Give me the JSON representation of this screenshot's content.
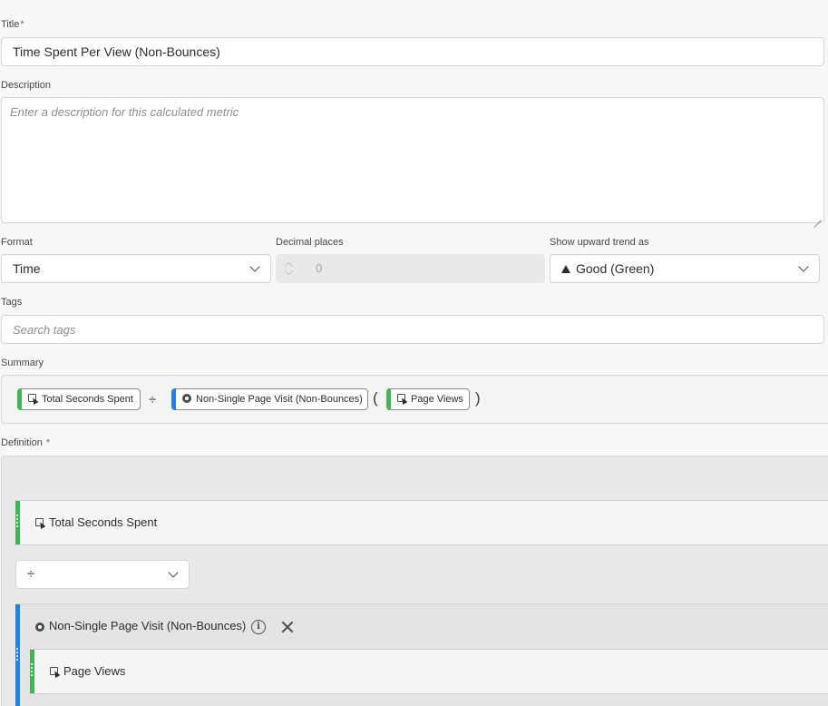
{
  "title": {
    "label": "Title",
    "required_mark": "*",
    "value": "Time Spent Per View (Non-Bounces)"
  },
  "description": {
    "label": "Description",
    "placeholder": "Enter a description for this calculated metric"
  },
  "format": {
    "label": "Format",
    "value": "Time"
  },
  "decimal_places": {
    "label": "Decimal places",
    "value": "0"
  },
  "upward_trend": {
    "label": "Show upward trend as",
    "value": "Good (Green)",
    "icon": "triangle-up-icon"
  },
  "tags": {
    "label": "Tags",
    "placeholder": "Search tags"
  },
  "summary": {
    "label": "Summary",
    "items": [
      {
        "type": "metric",
        "label": "Total Seconds Spent",
        "color": "#44b556",
        "icon": "metric-icon"
      },
      {
        "type": "operator",
        "label": "÷"
      },
      {
        "type": "segment",
        "label": "Non-Single Page Visit (Non-Bounces)",
        "color": "#2680eb",
        "icon": "segment-icon"
      },
      {
        "type": "paren",
        "label": "("
      },
      {
        "type": "metric",
        "label": "Page Views",
        "color": "#44b556",
        "icon": "metric-icon"
      },
      {
        "type": "paren",
        "label": ")"
      }
    ]
  },
  "definition": {
    "label": "Definition",
    "required_mark": "*",
    "metric1": {
      "label": "Total Seconds Spent",
      "color": "#44b556"
    },
    "operator": {
      "value": "÷"
    },
    "segment": {
      "label": "Non-Single Page Visit (Non-Bounces)",
      "color": "#2680eb",
      "info_icon": "info-icon",
      "close_icon": "close-icon"
    },
    "nested_metric": {
      "label": "Page Views",
      "color": "#44b556"
    }
  }
}
